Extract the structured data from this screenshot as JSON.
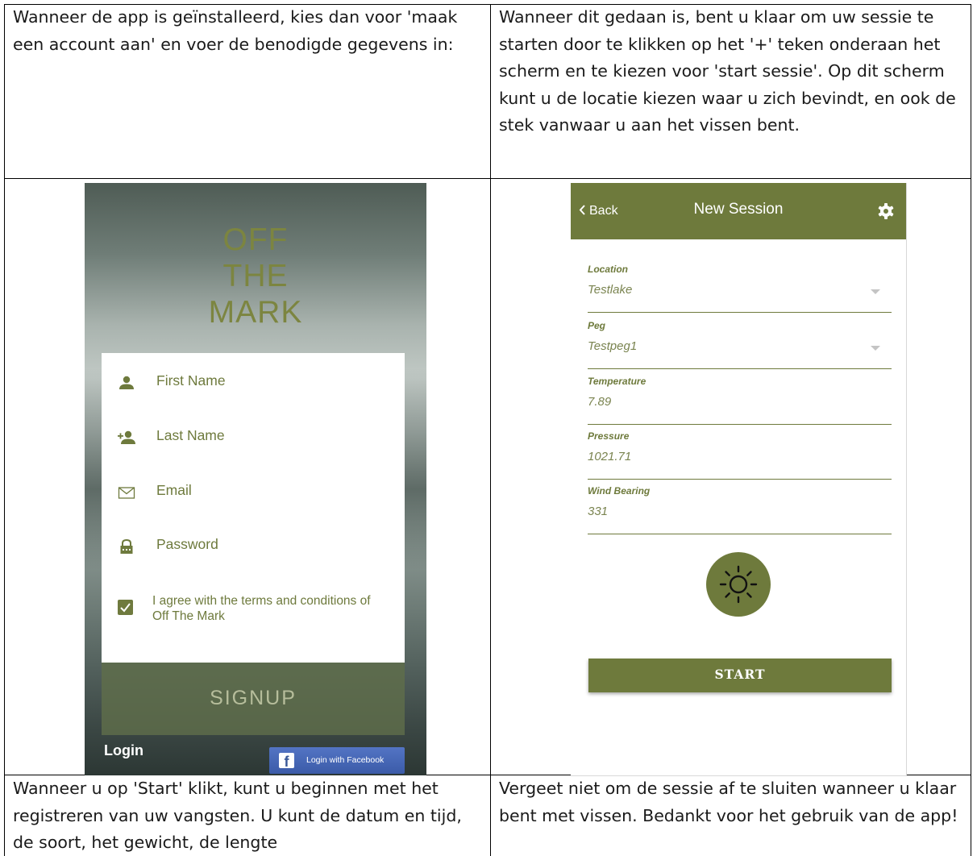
{
  "cells": {
    "top_left": "Wanneer de app is geïnstalleerd, kies dan voor 'maak een account aan' en voer de benodigde gegevens in:",
    "top_right": "Wanneer dit gedaan is, bent u klaar om uw sessie te starten door te klikken op het '+' teken onderaan het scherm en te kiezen voor 'start sessie'. Op dit scherm kunt u de locatie kiezen waar u zich bevindt, en ook de stek vanwaar u aan het vissen bent.",
    "bottom_left": "Wanneer u op 'Start' klikt, kunt u beginnen met het registreren van uw vangsten. U kunt de datum en tijd, de soort, het gewicht, de lengte",
    "bottom_right": "Vergeet niet om de sessie af te sluiten wanneer u klaar bent met vissen. Bedankt voor het gebruik van de app!"
  },
  "signup_screen": {
    "brand_line1": "OFF",
    "brand_line2": "THE",
    "brand_line3": "MARK",
    "fields": [
      {
        "label": "First Name",
        "icon": "person-icon"
      },
      {
        "label": "Last Name",
        "icon": "add-person-icon"
      },
      {
        "label": "Email",
        "icon": "envelope-icon"
      },
      {
        "label": "Password",
        "icon": "lock-icon"
      }
    ],
    "terms_checked": true,
    "terms_label": "I agree with the terms and conditions of Off The Mark",
    "signup_button": "SIGNUP",
    "login_link": "Login",
    "facebook_icon_letter": "f",
    "facebook_button": "Login with Facebook",
    "colors": {
      "accent": "#6e7a3d",
      "facebook": "#3b5998"
    }
  },
  "session_screen": {
    "back_label": "Back",
    "title": "New Session",
    "fields": [
      {
        "label": "Location",
        "value": "Testlake",
        "dropdown": true
      },
      {
        "label": "Peg",
        "value": "Testpeg1",
        "dropdown": true
      },
      {
        "label": "Temperature",
        "value": "7.89",
        "dropdown": false
      },
      {
        "label": "Pressure",
        "value": "1021.71",
        "dropdown": false
      },
      {
        "label": "Wind Bearing",
        "value": "331",
        "dropdown": false
      }
    ],
    "weather_icon": "sun-icon",
    "start_button": "START",
    "colors": {
      "header": "#6e7a3c"
    }
  }
}
